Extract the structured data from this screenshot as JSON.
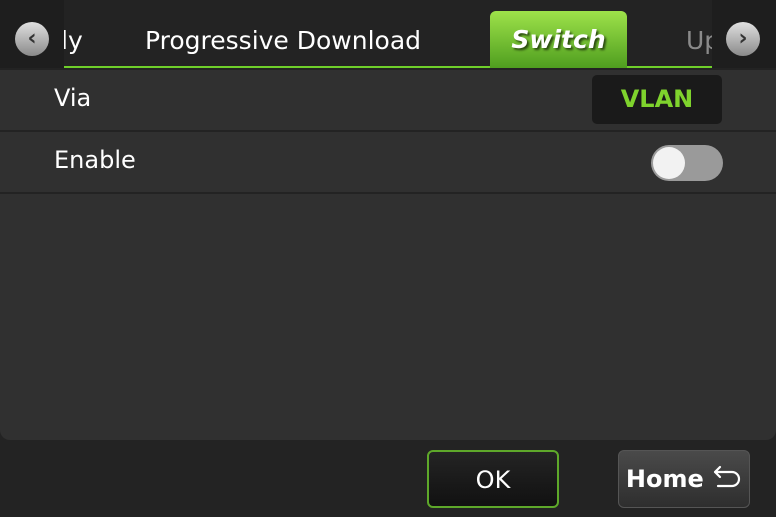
{
  "tabs": [
    {
      "label": "ly",
      "state": "partial"
    },
    {
      "label": "Progressive Download",
      "state": "normal"
    },
    {
      "label": "Switch",
      "state": "active"
    },
    {
      "label": "Up",
      "state": "partial"
    }
  ],
  "nav": {
    "prev_icon": "chevron-left-icon",
    "next_icon": "chevron-right-icon"
  },
  "rows": [
    {
      "label": "Via",
      "value": "VLAN"
    },
    {
      "label": "Enable",
      "toggle_on": false
    }
  ],
  "buttons": {
    "ok": "OK",
    "home": "Home",
    "home_icon": "return-arrow-icon"
  },
  "colors": {
    "accent": "#7fd32d"
  }
}
